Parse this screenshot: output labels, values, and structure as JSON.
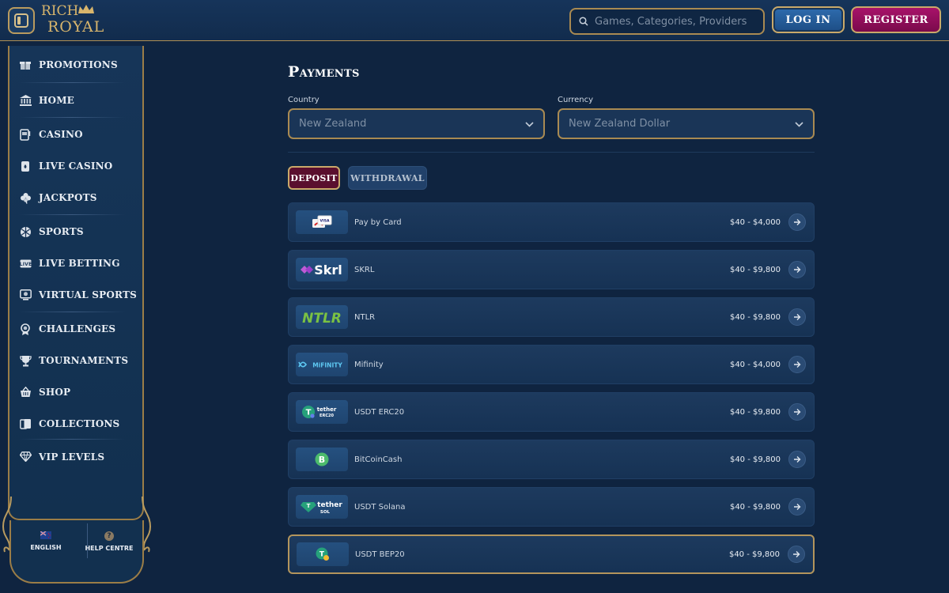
{
  "header": {
    "logo_line1": "RICH",
    "logo_line2": "ROYAL",
    "search_placeholder": "Games, Categories, Providers",
    "login_label": "LOG IN",
    "register_label": "REGISTER"
  },
  "sidebar": {
    "items": [
      {
        "label": "PROMOTIONS",
        "icon": "gift-icon"
      },
      {
        "label": "HOME",
        "icon": "bank-icon"
      },
      {
        "label": "CASINO",
        "icon": "slot-machine-icon"
      },
      {
        "label": "LIVE CASINO",
        "icon": "cards-icon"
      },
      {
        "label": "JACKPOTS",
        "icon": "clover-icon"
      },
      {
        "label": "SPORTS",
        "icon": "ball-icon"
      },
      {
        "label": "LIVE BETTING",
        "icon": "live-icon"
      },
      {
        "label": "VIRTUAL SPORTS",
        "icon": "screen-icon"
      },
      {
        "label": "CHALLENGES",
        "icon": "medal-icon"
      },
      {
        "label": "TOURNAMENTS",
        "icon": "trophy-icon"
      },
      {
        "label": "SHOP",
        "icon": "basket-icon"
      },
      {
        "label": "COLLECTIONS",
        "icon": "collection-cards-icon"
      },
      {
        "label": "VIP LEVELS",
        "icon": "diamond-icon"
      }
    ],
    "language_label": "ENGLISH",
    "help_label": "HELP CENTRE"
  },
  "main": {
    "title": "Payments",
    "country_label": "Country",
    "country_value": "New Zealand",
    "currency_label": "Currency",
    "currency_value": "New Zealand Dollar",
    "tab_deposit": "DEPOSIT",
    "tab_withdrawal": "WITHDRAWAL",
    "methods": [
      {
        "name": "Pay by Card",
        "range": "$40 - $4,000",
        "logo": "card"
      },
      {
        "name": "SKRL",
        "range": "$40 - $9,800",
        "logo": "Skrl"
      },
      {
        "name": "NTLR",
        "range": "$40 - $9,800",
        "logo": "NTLR"
      },
      {
        "name": "Mifinity",
        "range": "$40 - $4,000",
        "logo": "MiFINITY"
      },
      {
        "name": "USDT ERC20",
        "range": "$40 - $9,800",
        "logo": "tether ERC20"
      },
      {
        "name": "BitCoinCash",
        "range": "$40 - $9,800",
        "logo": "bitcoincash"
      },
      {
        "name": "USDT Solana",
        "range": "$40 - $9,800",
        "logo": "tether SOL"
      },
      {
        "name": "USDT BEP20",
        "range": "$40 - $9,800",
        "logo": "tether bep20"
      }
    ]
  },
  "colors": {
    "background": "#0f2440",
    "gold": "#c9a96a",
    "login_blue": "#2e6cae",
    "register_magenta": "#a8126a",
    "deposit_active": "#5a0f2e"
  }
}
